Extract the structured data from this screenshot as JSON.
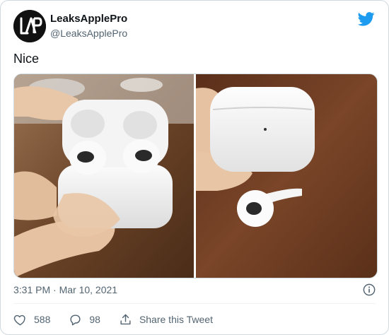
{
  "tweet": {
    "author": {
      "display_name": "LeaksApplePro",
      "handle": "@LeaksApplePro"
    },
    "text": "Nice",
    "timestamp": "3:31 PM · Mar 10, 2021",
    "actions": {
      "like_count": "588",
      "reply_count": "98",
      "share_label": "Share this Tweet"
    }
  },
  "colors": {
    "brand_blue": "#1d9bf0",
    "text_primary": "#0f1419",
    "text_secondary": "#536471",
    "border": "#cfd9de"
  },
  "icons": [
    "twitter-bird-icon",
    "info-icon",
    "heart-icon",
    "reply-bubble-icon",
    "share-icon"
  ]
}
